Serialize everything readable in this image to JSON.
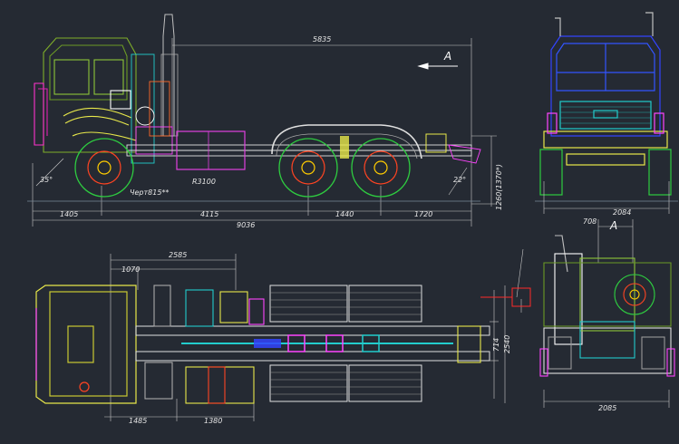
{
  "drawing": {
    "side_view": {
      "dim_overall_top": "5835",
      "view_marker": "A",
      "angle_front": "35°",
      "angle_rear": "22°",
      "tyre_label": "Черт815**",
      "radius_label": "R3100",
      "height_label": "1260(1370*)",
      "dims_bottom": [
        "1405",
        "4115",
        "1440",
        "1720"
      ],
      "dim_total": "9036"
    },
    "front_view": {
      "width": "2084"
    },
    "top_view": {
      "dim_top_1": "2585",
      "dim_top_2": "1070",
      "dim_bottom_1": "1485",
      "dim_bottom_2": "1380",
      "dim_right_1": "714",
      "dim_right_2": "2540"
    },
    "rear_view": {
      "view_marker": "A",
      "dim_top": "708",
      "dim_bottom": "2085"
    }
  }
}
